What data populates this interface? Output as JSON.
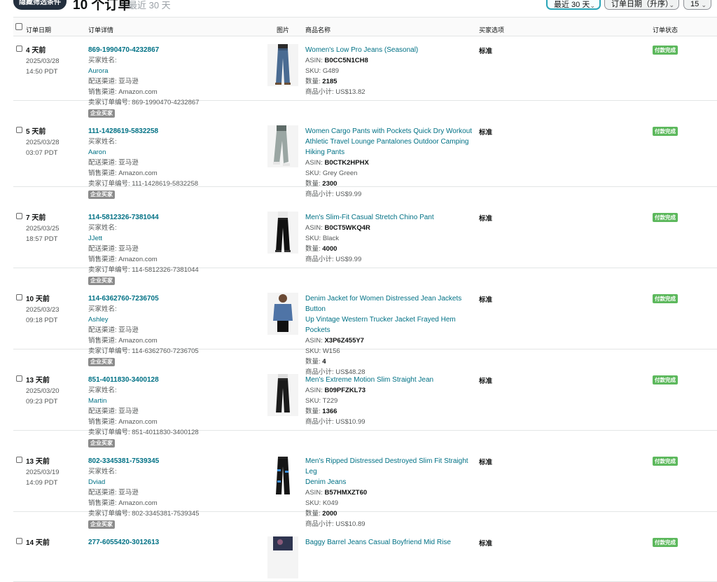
{
  "toolbar": {
    "filter_button": "隐藏筛选条件",
    "order_count": "10 个订单",
    "order_range": "最近 30 天",
    "date_select": "最近 30 天",
    "sort_select": "订单日期（升序）",
    "page_size_select": "15"
  },
  "headers": {
    "order_date": "订单日期",
    "order_details": "订单详情",
    "image": "图片",
    "product_name": "商品名称",
    "buyer_options": "买家选项",
    "order_status": "订单状态"
  },
  "labels": {
    "buyer_name": "买家姓名:",
    "shipping_channel": "配送渠道: 亚马逊",
    "sales_channel": "销售渠道: Amazon.com",
    "seller_order_prefix": "卖家订单编号: ",
    "business_badge": "企业买家",
    "asin": "ASIN:",
    "sku": "SKU:",
    "qty": "数量:",
    "subtotal": "商品小计:",
    "option": "标准",
    "status": "付款完成"
  },
  "orders": [
    {
      "ago": "4 天前",
      "date": "2025/03/28",
      "time": "14:50 PDT",
      "order_id": "869-1990470-4232867",
      "buyer": "Aurora",
      "seller_order": "卖家订单编号: 869-1990470-4232867",
      "product_lines": [
        "Women's Low Pro Jeans (Seasonal)"
      ],
      "asin": "B0CC5N1CH8",
      "sku": "G489",
      "qty": "2185",
      "subtotal": "US$13.82",
      "image": "jeans-women"
    },
    {
      "ago": "5 天前",
      "date": "2025/03/28",
      "time": "03:07 PDT",
      "order_id": "111-1428619-5832258",
      "buyer": "Aaron",
      "seller_order": "卖家订单编号: 111-1428619-5832258",
      "product_lines": [
        "Women Cargo Pants with Pockets Quick Dry Workout",
        "Athletic Travel Lounge Pantalones Outdoor Camping",
        "Hiking Pants"
      ],
      "asin": "B0CTK2HPHX",
      "sku": "Grey Green",
      "qty": "2300",
      "subtotal": "US$9.99",
      "image": "cargo-pants"
    },
    {
      "ago": "7 天前",
      "date": "2025/03/25",
      "time": "18:57 PDT",
      "order_id": "114-5812326-7381044",
      "buyer": "JJett",
      "seller_order": "卖家订单编号: 114-5812326-7381044",
      "product_lines": [
        "Men's Slim-Fit Casual Stretch Chino Pant"
      ],
      "asin": "B0CT5WKQ4R",
      "sku": "Black",
      "qty": "4000",
      "subtotal": "US$9.99",
      "image": "chino-black"
    },
    {
      "ago": "10 天前",
      "date": "2025/03/23",
      "time": "09:18 PDT",
      "order_id": "114-6362760-7236705",
      "buyer": "Ashley",
      "seller_order": "卖家订单编号: 114-6362760-7236705",
      "product_lines": [
        "Denim Jacket for Women Distressed Jean Jackets Button",
        "Up Vintage Western Trucker Jacket Frayed Hem Pockets"
      ],
      "asin": "X3P6Z455Y7",
      "sku": "W156",
      "qty": "4",
      "subtotal": "US$48.28",
      "image": "denim-jacket"
    },
    {
      "ago": "13 天前",
      "date": "2025/03/20",
      "time": "09:23 PDT",
      "order_id": "851-4011830-3400128",
      "buyer": "Martin",
      "seller_order": "卖家订单编号: 851-4011830-3400128",
      "product_lines": [
        " Men's Extreme Motion Slim Straight Jean"
      ],
      "asin": "B09PFZKL73",
      "sku": "T229",
      "qty": "1366",
      "subtotal": "US$10.99",
      "image": "jeans-black"
    },
    {
      "ago": "13 天前",
      "date": "2025/03/19",
      "time": "14:09 PDT",
      "order_id": "802-3345381-7539345",
      "buyer": "Dviad",
      "seller_order": "卖家订单编号: 802-3345381-7539345",
      "product_lines": [
        "Men's Ripped Distressed Destroyed Slim Fit Straight Leg",
        "Denim Jeans"
      ],
      "asin": "B57HMXZT60",
      "sku": "K049",
      "qty": "2000",
      "subtotal": "US$10.89",
      "image": "ripped-jeans"
    },
    {
      "ago": "14 天前",
      "date": "",
      "time": "",
      "order_id": "277-6055420-3012613",
      "buyer": "",
      "seller_order": "",
      "product_lines": [
        "Baggy Barrel Jeans Casual Boyfriend Mid Rise"
      ],
      "asin": "",
      "sku": "",
      "qty": "",
      "subtotal": "",
      "image": "barrel-jeans"
    }
  ]
}
